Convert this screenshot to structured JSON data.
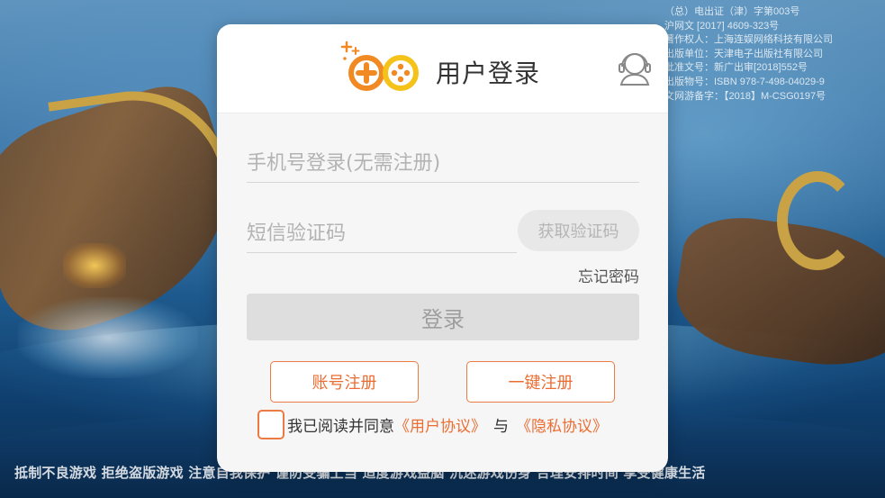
{
  "license": {
    "lines": [
      "（总）电出证（津）字第003号",
      "沪网文 [2017] 4609-323号",
      "著作权人：上海连娱网络科技有限公司",
      "出版单位：天津电子出版社有限公司",
      "批准文号：新广出审[2018]552号",
      "出版物号：ISBN 978-7-498-04029-9",
      "文网游备字：【2018】M-CSG0197号"
    ]
  },
  "advisory": "抵制不良游戏 拒绝盗版游戏 注意自我保护 谨防受骗上当 适度游戏益脑 沉迷游戏伤身 合理安排时间 享受健康生活",
  "dialog": {
    "title": "用户登录",
    "phone_placeholder": "手机号登录(无需注册)",
    "code_placeholder": "短信验证码",
    "get_code_label": "获取验证码",
    "forgot_label": "忘记密码",
    "login_label": "登录",
    "register_label": "账号注册",
    "quick_register_label": "一键注册",
    "agree_text": "我已阅读并同意",
    "user_agreement": "《用户协议》",
    "and_text": "与",
    "privacy_policy": "《隐私协议》"
  },
  "colors": {
    "accent_orange": "#ec6d33",
    "logo_orange": "#f28a23",
    "logo_yellow": "#f5c21a"
  },
  "icons": {
    "logo": "gamepad-plus-logo-icon",
    "service": "headset-service-icon"
  }
}
